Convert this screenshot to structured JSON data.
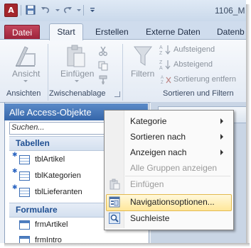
{
  "window": {
    "title": "1106_M",
    "app_icon": "A"
  },
  "qat": {
    "icons": [
      "access-app-icon",
      "save-icon",
      "undo-icon",
      "redo-icon",
      "customize-qat-icon"
    ]
  },
  "tabs": [
    "Datei",
    "Start",
    "Erstellen",
    "Externe Daten",
    "Datenb"
  ],
  "ribbon": {
    "groups": [
      "Ansichten",
      "Zwischenablage",
      "Sortieren und Filtern"
    ],
    "view_label": "Ansicht",
    "paste_label": "Einfügen",
    "filter_label": "Filtern",
    "sort_asc": "Aufsteigend",
    "sort_desc": "Absteigend",
    "sort_remove": "Sortierung entfern"
  },
  "nav": {
    "title": "Alle Access-Objekte",
    "search_placeholder": "Suchen...",
    "sections": [
      {
        "label": "Tabellen",
        "items": [
          "tblArtikel",
          "tblKategorien",
          "tblLieferanten"
        ]
      },
      {
        "label": "Formulare",
        "items": [
          "frmArtikel",
          "frmIntro"
        ]
      }
    ]
  },
  "context_menu": {
    "items": [
      {
        "label": "Kategorie",
        "submenu": true,
        "enabled": true
      },
      {
        "label": "Sortieren nach",
        "submenu": true,
        "enabled": true
      },
      {
        "label": "Anzeigen nach",
        "submenu": true,
        "enabled": true
      },
      {
        "label": "Alle Gruppen anzeigen",
        "submenu": false,
        "enabled": false
      },
      {
        "label": "Einfügen",
        "submenu": false,
        "enabled": false
      },
      {
        "label": "Navigationsoptionen...",
        "submenu": false,
        "enabled": true,
        "highlighted": true
      },
      {
        "label": "Suchleiste",
        "submenu": false,
        "enabled": true
      }
    ]
  },
  "colors": {
    "accent": "#3566aa",
    "file_tab": "#a82a43",
    "menu_highlight": "#ffe79a"
  }
}
